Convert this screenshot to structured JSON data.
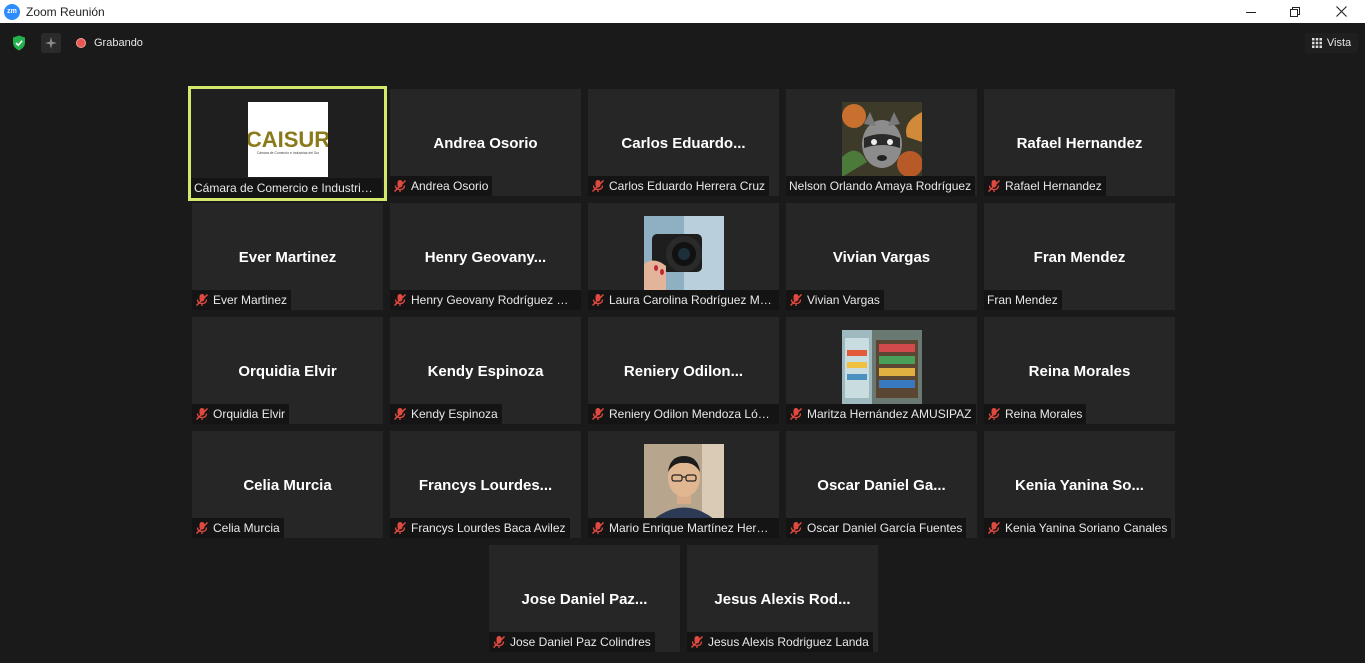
{
  "window": {
    "title": "Zoom Reunión",
    "app_logo_text": "zm"
  },
  "toolbar": {
    "recording_label": "Grabando",
    "view_label": "Vista"
  },
  "colors": {
    "active_speaker_border": "#d4e86e",
    "muted_icon": "#e0493f",
    "recording_dot": "#e8574f"
  },
  "participants": [
    {
      "display": "",
      "label": "Cámara de Comercio e Industrias del Sur",
      "muted": false,
      "active": true,
      "image": "caisur-logo",
      "logo_text": "CAISUR",
      "logo_subtitle": "Cámara de Comercio e Industrias del Sur"
    },
    {
      "display": "Andrea Osorio",
      "label": "Andrea Osorio",
      "muted": true
    },
    {
      "display": "Carlos  Eduardo...",
      "label": "Carlos Eduardo Herrera Cruz",
      "muted": true
    },
    {
      "display": "",
      "label": "Nelson Orlando Amaya Rodríguez",
      "muted": false,
      "image": "raccoon-art"
    },
    {
      "display": "Rafael Hernandez",
      "label": "Rafael Hernandez",
      "muted": true
    },
    {
      "display": "Ever Martinez",
      "label": "Ever Martinez",
      "muted": true
    },
    {
      "display": "Henry  Geovany...",
      "label": "Henry Geovany Rodríguez Martínez",
      "muted": true
    },
    {
      "display": "",
      "label": "Laura Carolina Rodríguez Mejía",
      "muted": true,
      "image": "camera-photo"
    },
    {
      "display": "Vivian Vargas",
      "label": "Vivian Vargas",
      "muted": true
    },
    {
      "display": "Fran Mendez",
      "label": "Fran Mendez",
      "muted": false
    },
    {
      "display": "Orquidia Elvir",
      "label": "Orquidia Elvir",
      "muted": true
    },
    {
      "display": "Kendy Espinoza",
      "label": "Kendy Espinoza",
      "muted": true
    },
    {
      "display": "Reniery  Odilon...",
      "label": "Reniery Odilon Mendoza López",
      "muted": true
    },
    {
      "display": "",
      "label": "Maritza Hernández AMUSIPAZ",
      "muted": true,
      "image": "store-photo"
    },
    {
      "display": "Reina Morales",
      "label": "Reina Morales",
      "muted": true
    },
    {
      "display": "Celia Murcia",
      "label": "Celia Murcia",
      "muted": true
    },
    {
      "display": "Francys  Lourdes...",
      "label": "Francys Lourdes Baca Avilez",
      "muted": true
    },
    {
      "display": "",
      "label": "Mario Enrique Martínez Hernández",
      "muted": true,
      "image": "man-photo"
    },
    {
      "display": "Oscar  Daniel  Ga...",
      "label": "Oscar Daniel García Fuentes",
      "muted": true
    },
    {
      "display": "Kenia  Yanina  So...",
      "label": "Kenia Yanina Soriano Canales",
      "muted": true
    },
    {
      "display": "Jose  Daniel  Paz...",
      "label": "Jose Daniel Paz Colindres",
      "muted": true
    },
    {
      "display": "Jesus  Alexis  Rod...",
      "label": "Jesus Alexis Rodriguez Landa",
      "muted": true
    }
  ]
}
